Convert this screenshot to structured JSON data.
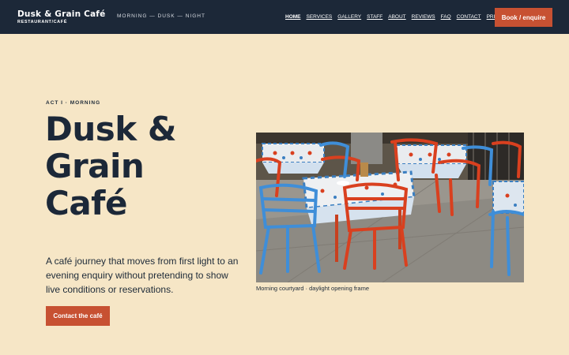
{
  "brand": {
    "name": "Dusk & Grain Café",
    "subtitle": "RESTAURANT/CAFÉ",
    "tagline": "MORNING — DUSK — NIGHT"
  },
  "nav": {
    "items": [
      {
        "label": "HOME",
        "active": true
      },
      {
        "label": "SERVICES"
      },
      {
        "label": "GALLERY"
      },
      {
        "label": "STAFF"
      },
      {
        "label": "ABOUT"
      },
      {
        "label": "REVIEWS"
      },
      {
        "label": "FAQ"
      },
      {
        "label": "CONTACT"
      },
      {
        "label": "PRIVACY"
      }
    ],
    "cta_label": "Book / enquire"
  },
  "hero": {
    "kicker": "ACT I · MORNING",
    "title": "Dusk & Grain Café",
    "body": "A café journey that moves from first light to an evening enquiry without pretending to show live conditions or reservations.",
    "cta_label": "Contact the café",
    "image_caption": "Morning courtyard · daylight opening frame"
  },
  "colors": {
    "background": "#f6e6c6",
    "header": "#1c2838",
    "accent": "#c75132",
    "text": "#1d2a38"
  }
}
